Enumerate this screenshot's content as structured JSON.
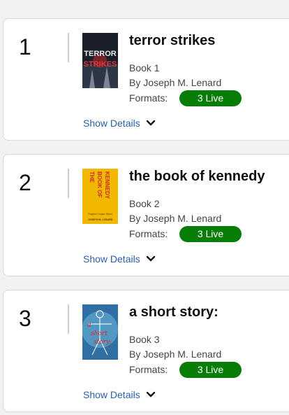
{
  "books": [
    {
      "number": "1",
      "title": "terror strikes",
      "book_label": "Book 1",
      "author": "By Joseph M. Lenard",
      "formats_label": "Formats:",
      "formats_badge": "3 Live",
      "details_label": "Show Details",
      "cover": {
        "line1": "TERROR",
        "line2": "STRIKES"
      }
    },
    {
      "number": "2",
      "title": "the book of kennedy",
      "book_label": "Book 2",
      "author": "By Joseph M. Lenard",
      "formats_label": "Formats:",
      "formats_badge": "3 Live",
      "details_label": "Show Details",
      "cover": {
        "line1": "THE",
        "line2": "BOOK OF",
        "line3": "KENNEDY",
        "line4": "Project Carpe Diem",
        "line5": "JOSEPH M. LENARD"
      }
    },
    {
      "number": "3",
      "title": "a short story:",
      "book_label": "Book 3",
      "author": "By Joseph M. Lenard",
      "formats_label": "Formats:",
      "formats_badge": "3 Live",
      "details_label": "Show Details",
      "cover": {
        "line1": "a",
        "line2": "short",
        "line3": "story:"
      }
    }
  ],
  "colors": {
    "badge": "#067d06",
    "link": "#2a5ea8"
  }
}
